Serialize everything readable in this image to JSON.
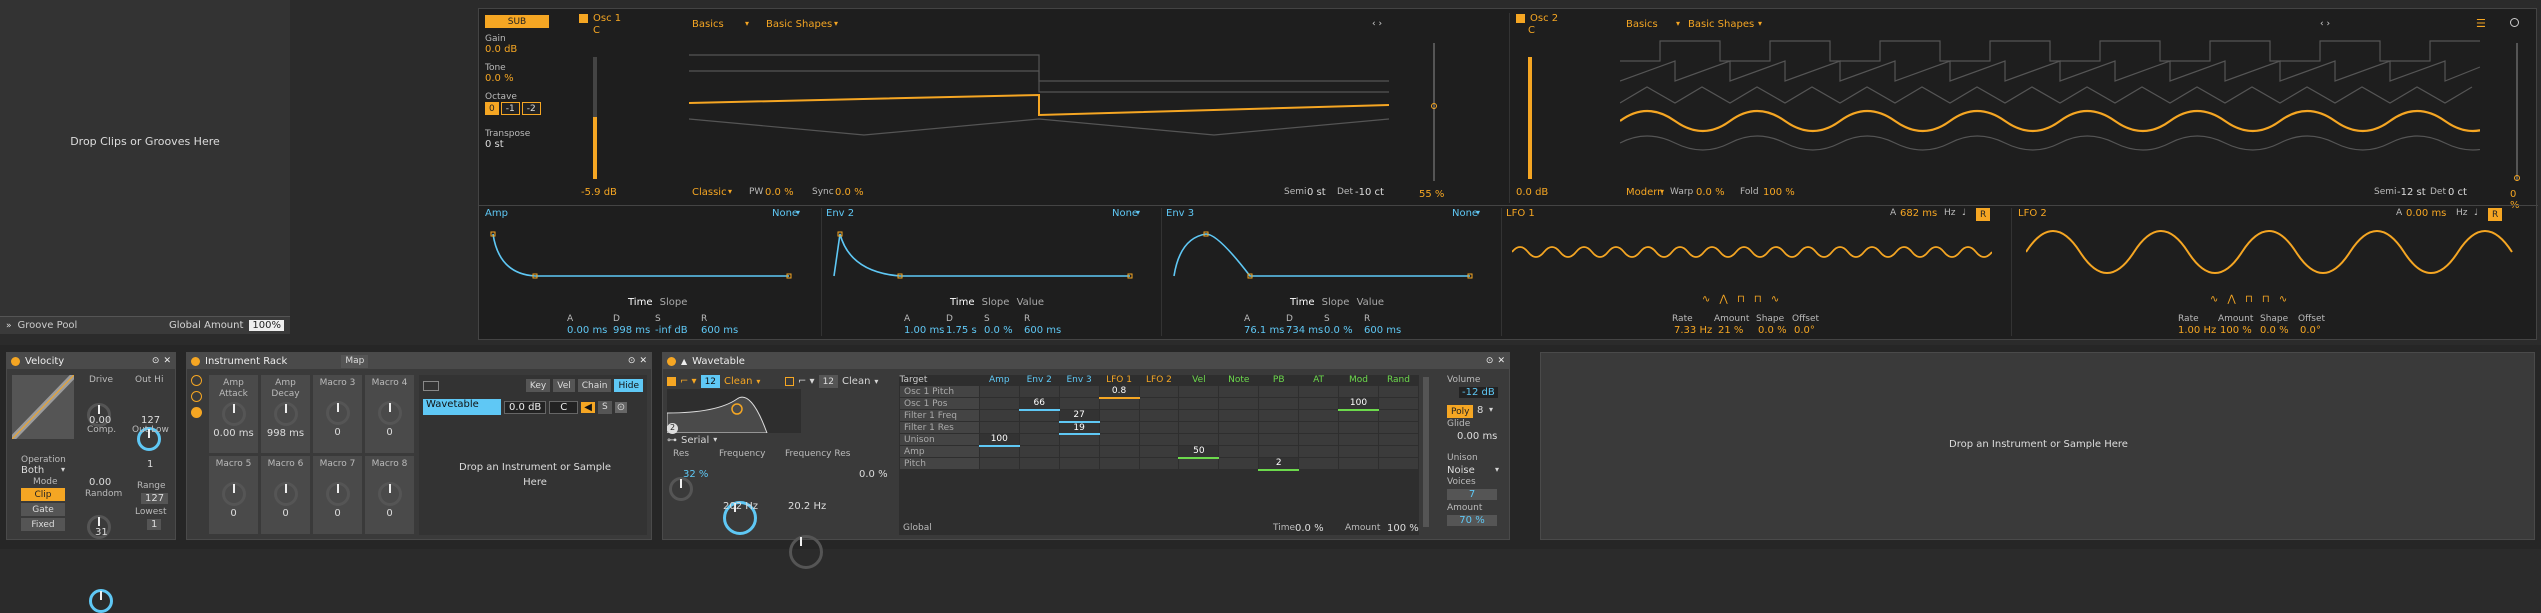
{
  "groove_pool": {
    "drop_text": "Drop Clips or Grooves Here",
    "title": "Groove Pool",
    "global_amount_label": "Global Amount",
    "global_amount_value": "100%"
  },
  "osc1": {
    "sub_label": "SUB",
    "gain_label": "Gain",
    "gain_value": "0.0 dB",
    "tone_label": "Tone",
    "tone_value": "0.0 %",
    "octave_label": "Octave",
    "octave_buttons": [
      "0",
      "-1",
      "-2"
    ],
    "transpose_label": "Transpose",
    "transpose_value": "0 st",
    "name": "Osc 1",
    "note": "C",
    "level": "-5.9 dB",
    "category": "Basics",
    "wavetable": "Basic Shapes",
    "mode": "Classic",
    "pw_label": "PW",
    "pw_value": "0.0 %",
    "sync_label": "Sync",
    "sync_value": "0.0 %",
    "semi_label": "Semi",
    "semi_value": "0 st",
    "det_label": "Det",
    "det_value": "-10 ct",
    "position_value": "55 %"
  },
  "osc2": {
    "name": "Osc 2",
    "note": "C",
    "level": "0.0 dB",
    "category": "Basics",
    "wavetable": "Basic Shapes",
    "mode": "Modern",
    "warp_label": "Warp",
    "warp_value": "0.0 %",
    "fold_label": "Fold",
    "fold_value": "100 %",
    "semi_label": "Semi",
    "semi_value": "-12 st",
    "det_label": "Det",
    "det_value": "0 ct",
    "position_value": "0 %"
  },
  "envelopes": [
    {
      "name": "Amp",
      "target": "None",
      "time": "Time",
      "slope": "Slope",
      "value": "",
      "a_label": "A",
      "a": "0.00 ms",
      "d_label": "D",
      "d": "998 ms",
      "s_label": "S",
      "s": "-inf dB",
      "r_label": "R",
      "r": "600 ms"
    },
    {
      "name": "Env 2",
      "target": "None",
      "time": "Time",
      "slope": "Slope",
      "value": "Value",
      "a_label": "A",
      "a": "1.00 ms",
      "d_label": "D",
      "d": "1.75 s",
      "s_label": "S",
      "s": "0.0 %",
      "r_label": "R",
      "r": "600 ms"
    },
    {
      "name": "Env 3",
      "target": "None",
      "time": "Time",
      "slope": "Slope",
      "value": "Value",
      "a_label": "A",
      "a": "76.1 ms",
      "d_label": "D",
      "d": "734 ms",
      "s_label": "S",
      "s": "0.0 %",
      "r_label": "R",
      "r": "600 ms"
    }
  ],
  "lfos": [
    {
      "name": "LFO 1",
      "a_label": "A",
      "a_value": "682 ms",
      "hz": "Hz",
      "note_sym": "♩",
      "r": "R",
      "rate_label": "Rate",
      "rate": "7.33 Hz",
      "amount_label": "Amount",
      "amount": "21 %",
      "shape_label": "Shape",
      "shape": "0.0 %",
      "offset_label": "Offset",
      "offset": "0.0°"
    },
    {
      "name": "LFO 2",
      "a_label": "A",
      "a_value": "0.00 ms",
      "hz": "Hz",
      "note_sym": "♩",
      "r": "R",
      "rate_label": "Rate",
      "rate": "1.00 Hz",
      "amount_label": "Amount",
      "amount": "100 %",
      "shape_label": "Shape",
      "shape": "0.0 %",
      "offset_label": "Offset",
      "offset": "0.0°"
    }
  ],
  "velocity": {
    "title": "Velocity",
    "drive_label": "Drive",
    "drive_value": "0.00",
    "outhi_label": "Out Hi",
    "outhi_value": "127",
    "comp_label": "Comp.",
    "comp_value": "0.00",
    "outlow_label": "Out Low",
    "outlow_value": "1",
    "operation_label": "Operation",
    "operation_value": "Both",
    "mode_label": "Mode",
    "mode_buttons": [
      "Clip",
      "Gate",
      "Fixed"
    ],
    "random_label": "Random",
    "random_value": "31",
    "range_label": "Range",
    "range_value": "127",
    "lowest_label": "Lowest",
    "lowest_value": "1"
  },
  "rack": {
    "title": "Instrument Rack",
    "map_label": "Map",
    "macros": [
      {
        "name": "Amp Attack",
        "value": "0.00 ms"
      },
      {
        "name": "Amp Decay",
        "value": "998 ms"
      },
      {
        "name": "Macro 3",
        "value": "0"
      },
      {
        "name": "Macro 4",
        "value": "0"
      },
      {
        "name": "Macro 5",
        "value": "0"
      },
      {
        "name": "Macro 6",
        "value": "0"
      },
      {
        "name": "Macro 7",
        "value": "0"
      },
      {
        "name": "Macro 8",
        "value": "0"
      }
    ],
    "chain_tabs": [
      "Key",
      "Vel",
      "Chain",
      "Hide"
    ],
    "chain_name": "Wavetable",
    "chain_vol": "0.0 dB",
    "chain_pan": "C",
    "chain_s": "S",
    "drop_text": "Drop an Instrument or Sample Here"
  },
  "wavetable": {
    "title": "Wavetable",
    "filter_num": "12",
    "filter_type": "Clean",
    "filter2_num": "12",
    "filter2_type": "Clean",
    "routing_label": "Serial",
    "res_label": "Res",
    "res_value": "32 %",
    "freq_label": "Frequency",
    "freq_value": "202 Hz",
    "freqres_label": "Frequency Res",
    "freqres_value": "20.2 Hz",
    "freqres_pct": "0.0 %",
    "filter_badge": "2",
    "matrix_headers": [
      "Target",
      "Amp",
      "Env 2",
      "Env 3",
      "LFO 1",
      "LFO 2",
      "Vel",
      "Note",
      "PB",
      "AT",
      "Mod",
      "Rand"
    ],
    "matrix_rows": [
      {
        "name": "Osc 1 Pitch",
        "cells": [
          "",
          "",
          "",
          "0.8",
          "",
          "",
          "",
          "",
          "",
          "",
          ""
        ]
      },
      {
        "name": "Osc 1 Pos",
        "cells": [
          "",
          "66",
          "",
          "",
          "",
          "",
          "",
          "",
          "",
          "100",
          ""
        ]
      },
      {
        "name": "Filter 1 Freq",
        "cells": [
          "",
          "",
          "27",
          "",
          "",
          "",
          "",
          "",
          "",
          "",
          ""
        ]
      },
      {
        "name": "Filter 1 Res",
        "cells": [
          "",
          "",
          "19",
          "",
          "",
          "",
          "",
          "",
          "",
          "",
          ""
        ]
      },
      {
        "name": "Unison",
        "cells": [
          "100",
          "",
          "",
          "",
          "",
          "",
          "",
          "",
          "",
          "",
          ""
        ]
      },
      {
        "name": "Amp",
        "cells": [
          "",
          "",
          "",
          "",
          "",
          "50",
          "",
          "",
          "",
          "",
          ""
        ]
      },
      {
        "name": "Pitch",
        "cells": [
          "",
          "",
          "",
          "",
          "",
          "",
          "",
          "2",
          "",
          "",
          ""
        ]
      }
    ],
    "global_label": "Global",
    "time_label": "Time",
    "time_value": "0.0 %",
    "amount_label": "Amount",
    "amount_value": "100 %",
    "volume_label": "Volume",
    "volume_value": "-12 dB",
    "poly_label": "Poly",
    "poly_value": "8",
    "glide_label": "Glide",
    "glide_value": "0.00 ms",
    "unison_label": "Unison",
    "unison_value": "Noise",
    "voices_label": "Voices",
    "voices_value": "7",
    "amount2_label": "Amount",
    "amount2_value": "70 %"
  },
  "right_drop": {
    "text": "Drop an Instrument or Sample Here"
  },
  "colors": {
    "accent": "#f5a623",
    "blue": "#5fc8f5",
    "green": "#6cd94c",
    "bg": "#1e1e1e"
  }
}
